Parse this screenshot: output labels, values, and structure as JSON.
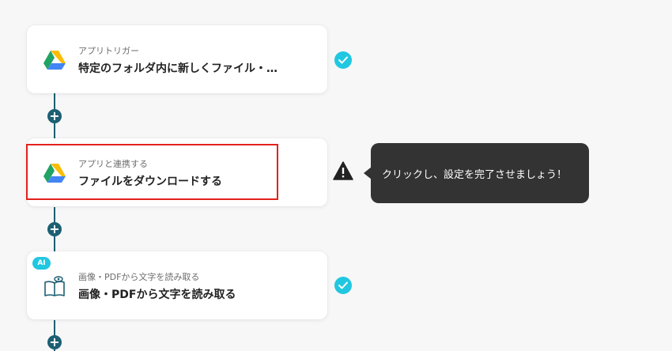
{
  "flow": {
    "steps": [
      {
        "subtitle": "アプリトリガー",
        "title": "特定のフォルダ内に新しくファイル・…",
        "icon": "google-drive-icon",
        "status": "completed"
      },
      {
        "subtitle": "アプリと連携する",
        "title": "ファイルをダウンロードする",
        "icon": "google-drive-icon",
        "status": "warning"
      },
      {
        "subtitle": "画像・PDFから文字を読み取る",
        "title": "画像・PDFから文字を読み取る",
        "icon": "book-eye-icon",
        "status": "completed",
        "badge": "AI"
      }
    ],
    "add_button_symbol": "+"
  },
  "tooltip": {
    "text": "クリックし、設定を完了させましょう！"
  },
  "colors": {
    "connector": "#1d5f73",
    "check": "#21c7e0",
    "highlight": "#e3211c",
    "tooltip_bg": "#333333"
  }
}
